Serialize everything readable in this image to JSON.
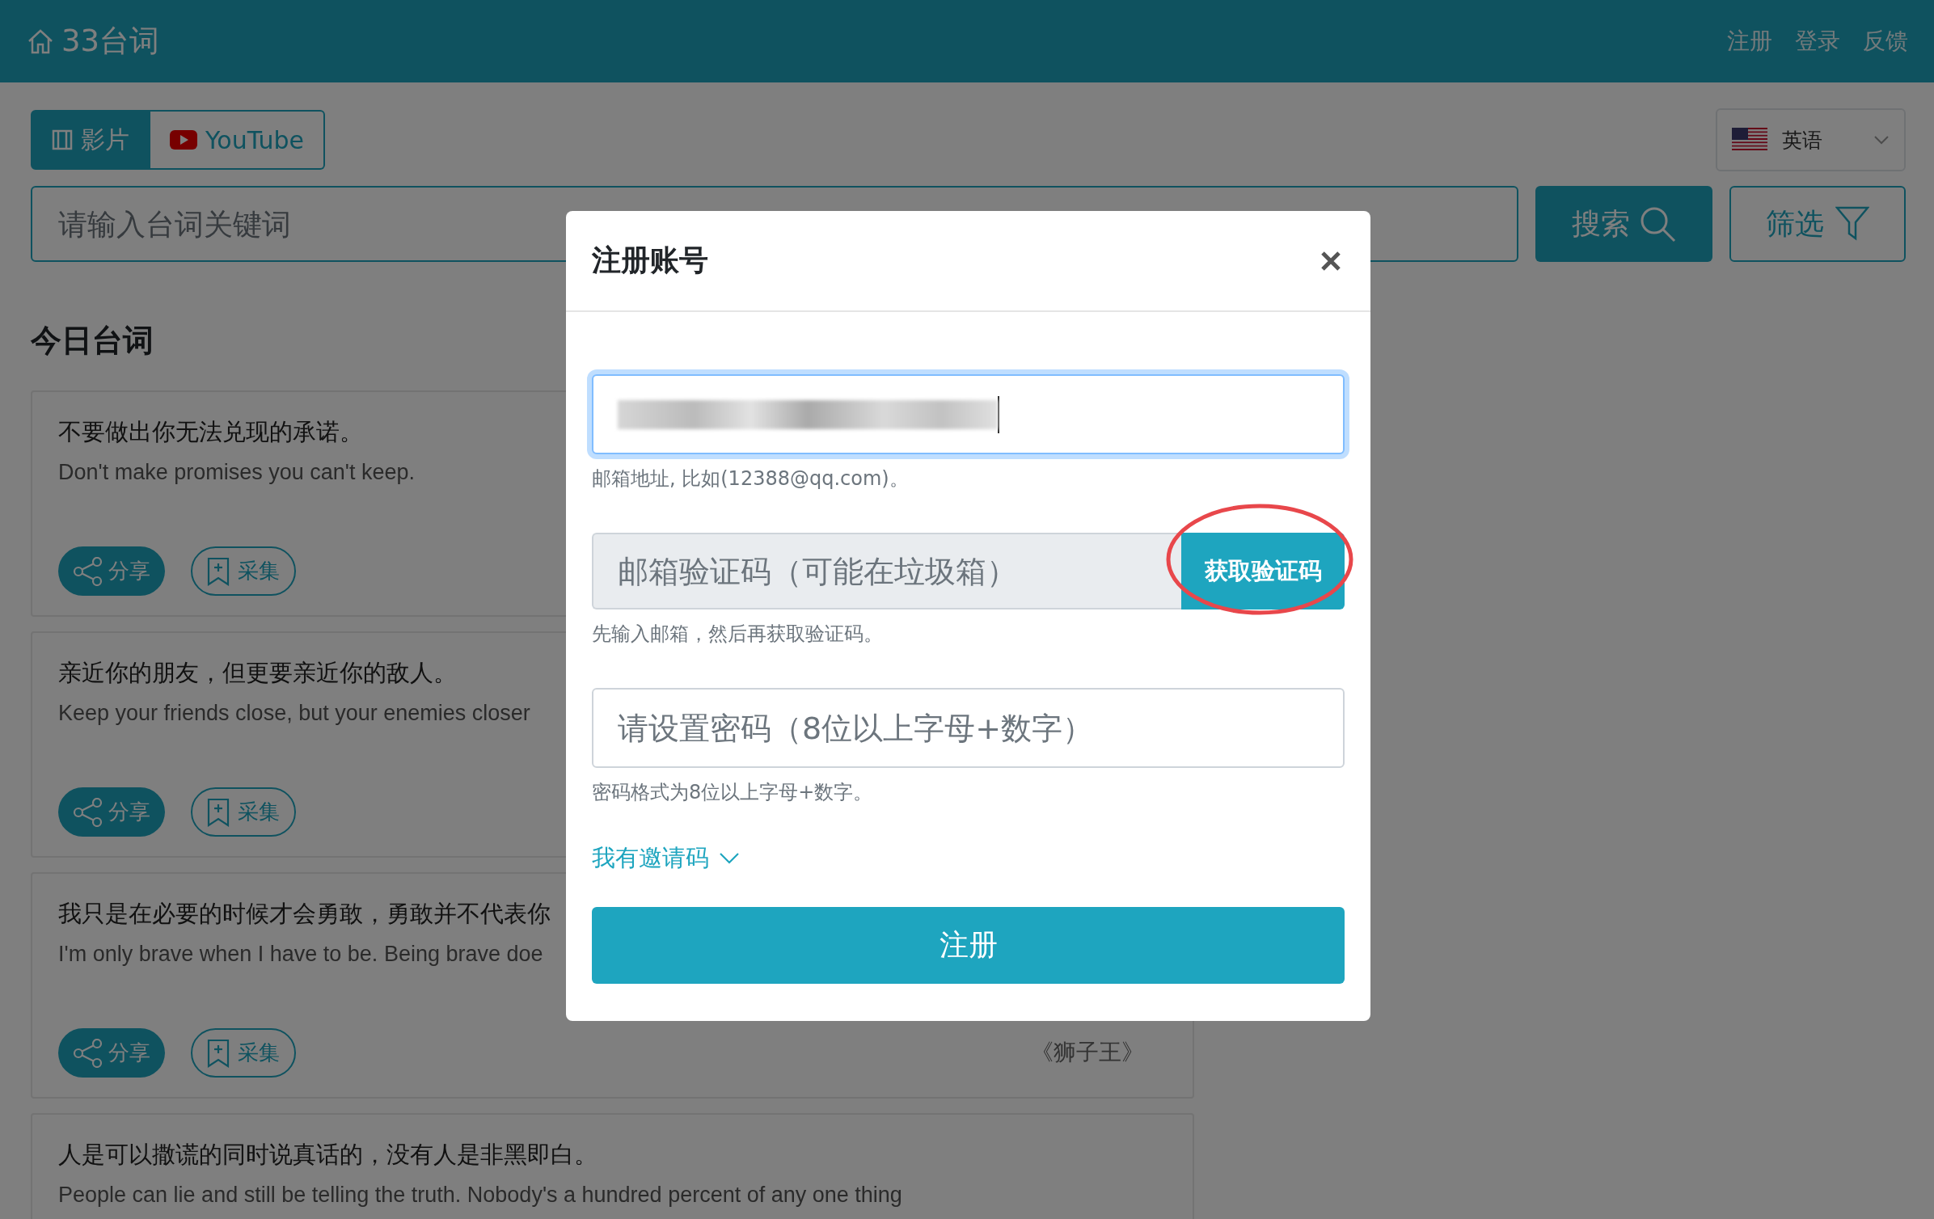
{
  "header": {
    "brand": "33台词",
    "nav": [
      "注册",
      "登录",
      "反馈"
    ]
  },
  "source_tabs": [
    {
      "label": "影片",
      "kind": "film",
      "selected": true
    },
    {
      "label": "YouTube",
      "kind": "youtube",
      "selected": false
    }
  ],
  "language": {
    "label": "英语"
  },
  "search": {
    "placeholder": "请输入台词关键词",
    "button": "搜索",
    "filter_button": "筛选"
  },
  "section_title": "今日台词",
  "cards": [
    {
      "zh": "不要做出你无法兑现的承诺。",
      "en": "Don't make promises you can't keep.",
      "actions": [
        "分享",
        "采集"
      ]
    },
    {
      "zh": "亲近你的朋友，但更要亲近你的敌人。",
      "en": "Keep your friends close, but your enemies closer",
      "actions": [
        "分享",
        "采集"
      ]
    },
    {
      "zh": "我只是在必要的时候才会勇敢，勇敢并不代表你",
      "en": "I'm only brave when I have to be. Being brave doe",
      "source": "《狮子王》",
      "actions": [
        "分享",
        "采集"
      ]
    },
    {
      "zh": "人是可以撒谎的同时说真话的，没有人是非黑即白。",
      "en": "People can lie and still be telling the truth. Nobody's a hundred percent of any one thing"
    }
  ],
  "modal": {
    "title": "注册账号",
    "email_field": {
      "focused": true,
      "value_redacted": true
    },
    "email_help": "邮箱地址, 比如(12388@qq.com)。",
    "code_field": {
      "placeholder": "邮箱验证码（可能在垃圾箱）"
    },
    "code_button": {
      "label": "获取验证码",
      "circled": true
    },
    "code_help": "先输入邮箱，然后再获取验证码。",
    "password_field": {
      "placeholder": "请设置密码（8位以上字母+数字）"
    },
    "password_help": "密码格式为8位以上字母+数字。",
    "invite_link": "我有邀请码",
    "submit": "注册"
  }
}
